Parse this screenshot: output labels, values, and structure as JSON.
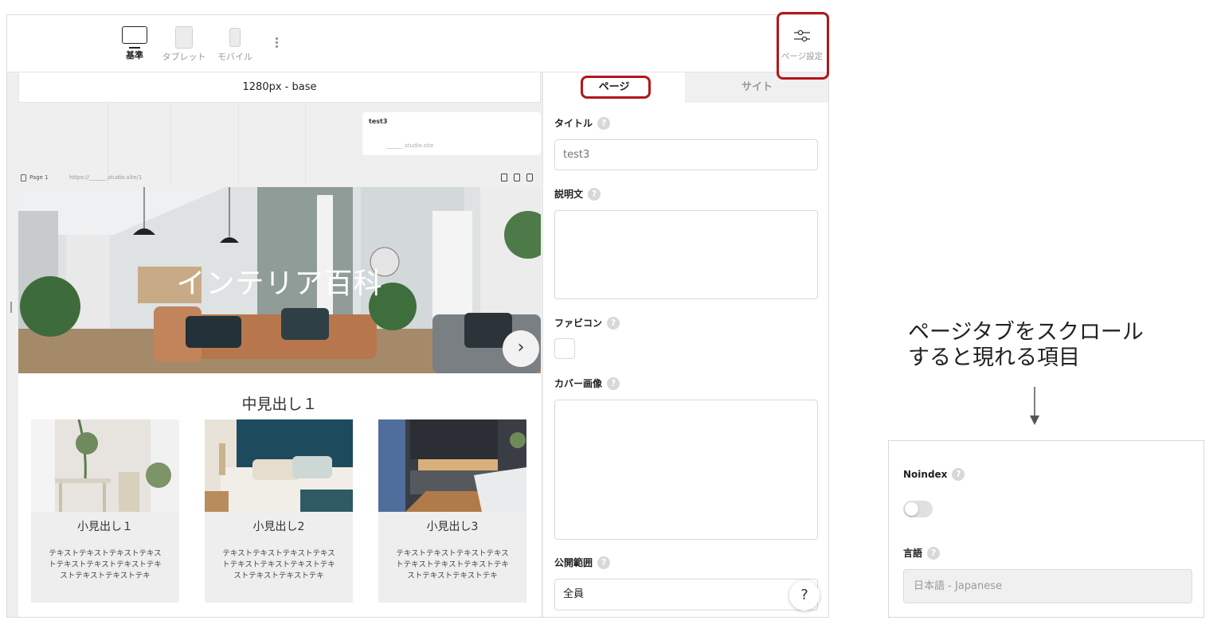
{
  "toolbar": {
    "devices": [
      {
        "label": "基準"
      },
      {
        "label": "タブレット"
      },
      {
        "label": "モバイル"
      }
    ],
    "page_settings_label": "ページ設定"
  },
  "canvas": {
    "breakpoint_label": "1280px - base",
    "page_card": {
      "title": "test3",
      "url": "______.studio.site"
    },
    "page_bar": {
      "name": "Page 1",
      "url": "https://______.studio.site/1"
    },
    "hero": {
      "title": "インテリア百科",
      "next_symbol": "›"
    },
    "section_heading": "中見出し１",
    "cards": [
      {
        "title": "小見出し１",
        "text": "テキストテキストテキストテキストテキストテキストテキストテキストテキストテキストテキ"
      },
      {
        "title": "小見出し2",
        "text": "テキストテキストテキストテキストテキストテキストテキストテキストテキストテキストテキ"
      },
      {
        "title": "小見出し3",
        "text": "テキストテキストテキストテキストテキストテキストテキストテキストテキストテキストテキ"
      }
    ]
  },
  "panel": {
    "tabs": {
      "page": "ページ",
      "site": "サイト"
    },
    "title_label": "タイトル",
    "title_placeholder": "test3",
    "description_label": "説明文",
    "favicon_label": "ファビコン",
    "cover_label": "カバー画像",
    "visibility_label": "公開範囲",
    "visibility_value": "全員",
    "help_symbol": "?"
  },
  "annotation": {
    "line1": "ページタブをスクロール",
    "line2": "すると現れる項目",
    "arrow": "↓"
  },
  "scroll_panel": {
    "noindex_label": "Noindex",
    "noindex_enabled": false,
    "language_label": "言語",
    "language_value": "日本語 - Japanese"
  },
  "colors": {
    "highlight": "#b5151d",
    "selected_tab": "#ffffff",
    "unselected_tab": "#f0f0f0"
  }
}
